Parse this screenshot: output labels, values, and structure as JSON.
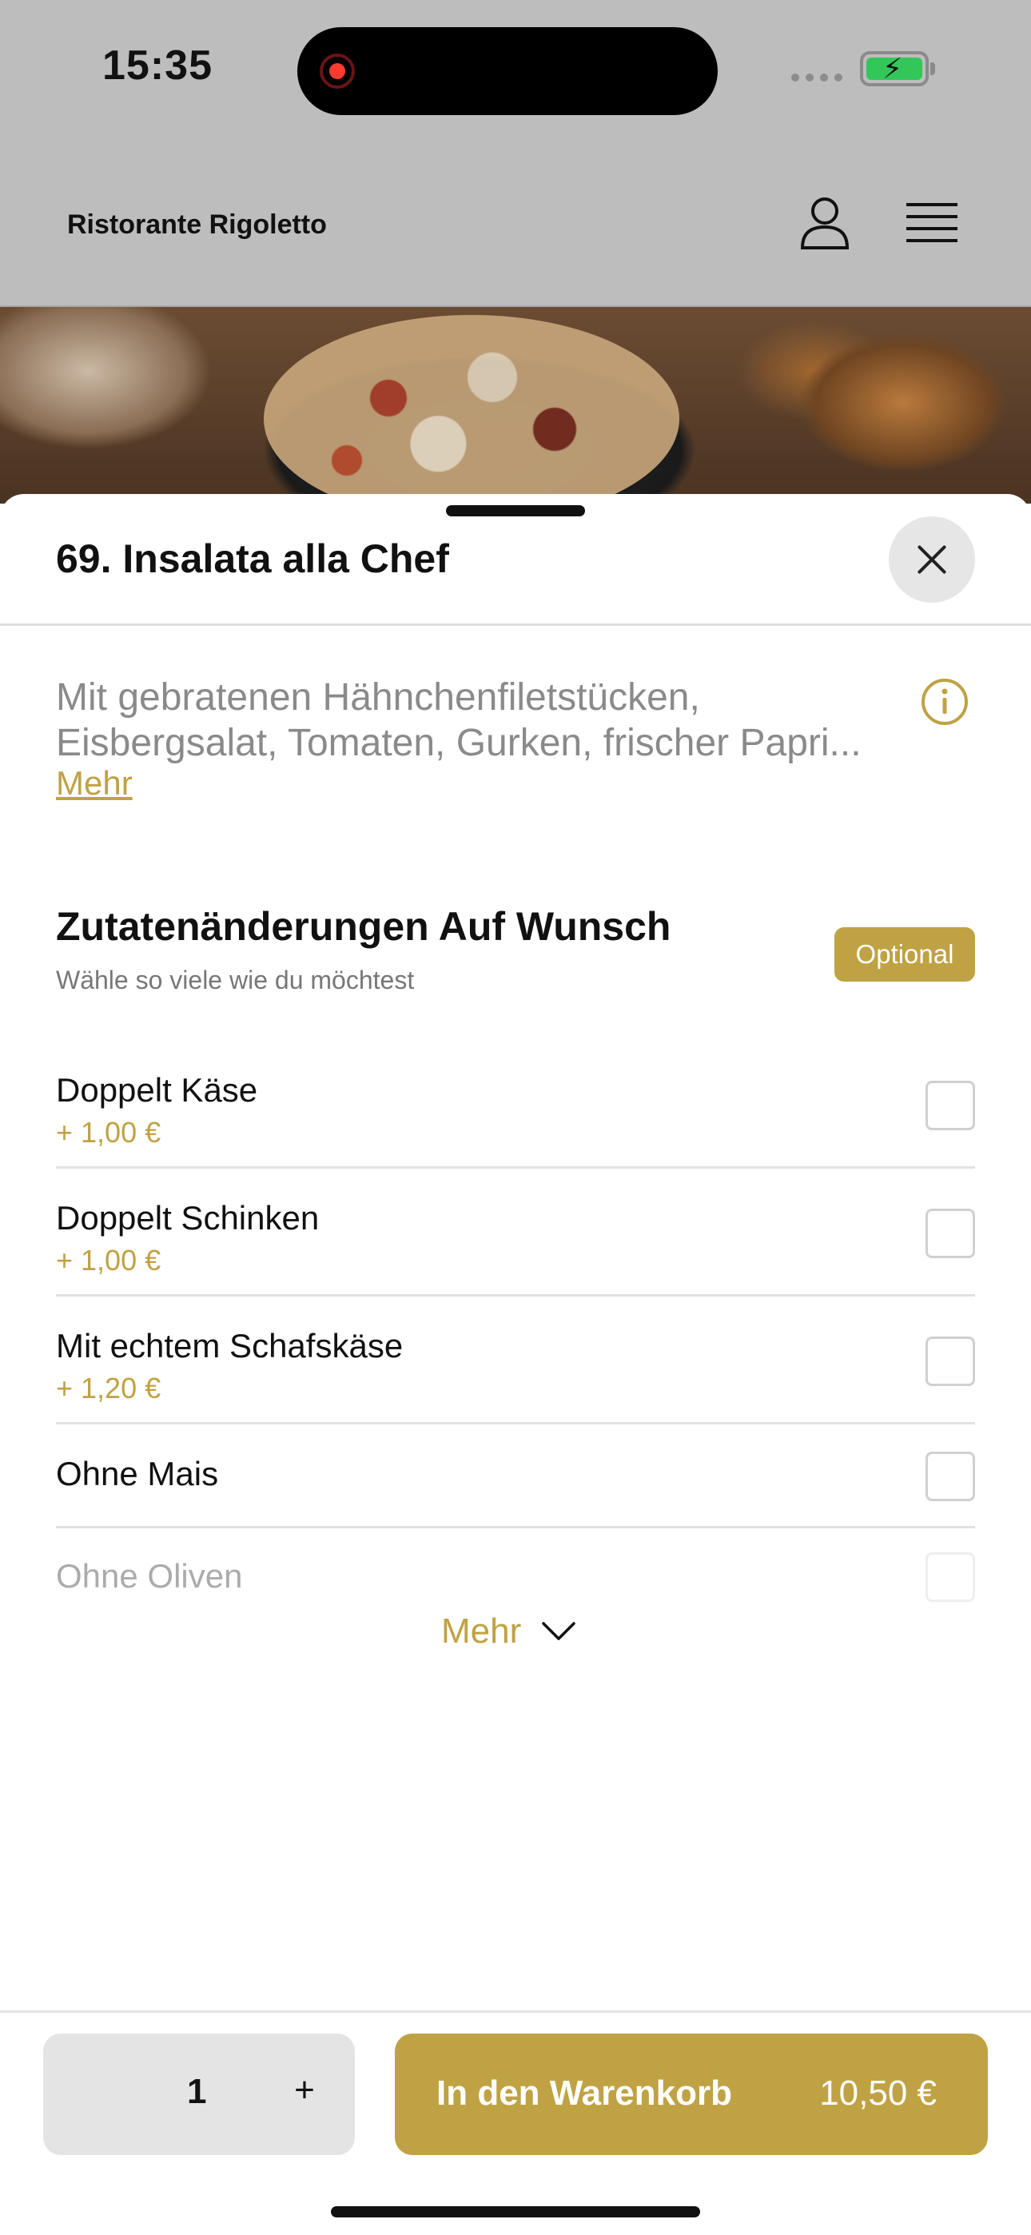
{
  "status_bar": {
    "time": "15:35",
    "battery_state": "charging"
  },
  "header": {
    "brand": "Ristorante Rigoletto",
    "icons": [
      "user-icon",
      "menu-icon"
    ]
  },
  "sheet": {
    "title": "69. Insalata alla Chef",
    "description_lines": [
      "Mit gebratenen Hähnchenfiletstücken,",
      "Eisbergsalat, Tomaten, Gurken, frischer Papri..."
    ],
    "description_more": "Mehr",
    "section": {
      "title": "Zutatenänderungen Auf Wunsch",
      "subtitle": "Wähle so viele wie du möchtest",
      "badge": "Optional"
    },
    "options": [
      {
        "name": "Doppelt Käse",
        "price": "+ 1,00 €",
        "checked": false
      },
      {
        "name": "Doppelt Schinken",
        "price": "+ 1,00 €",
        "checked": false
      },
      {
        "name": "Mit echtem Schafskäse",
        "price": "+ 1,20 €",
        "checked": false
      },
      {
        "name": "Ohne Mais",
        "checked": false
      },
      {
        "name": "Ohne Oliven",
        "checked": false
      }
    ],
    "more_label": "Mehr"
  },
  "footer": {
    "quantity": "1",
    "plus": "+",
    "cart_label": "In den Warenkorb",
    "cart_price": "10,50 €"
  },
  "colors": {
    "accent": "#bfa244",
    "overlay": "#bdbdbd"
  }
}
